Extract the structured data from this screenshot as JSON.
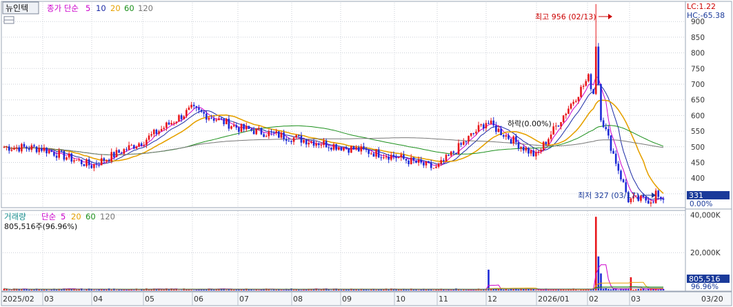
{
  "stock_name": "뉴인텍",
  "price_panel": {
    "ma_label": "종가 단순",
    "ma_periods": [
      {
        "label": "5",
        "color": "#cc00cc"
      },
      {
        "label": "10",
        "color": "#1c2ba6"
      },
      {
        "label": "20",
        "color": "#e6a100"
      },
      {
        "label": "60",
        "color": "#1a8f1a"
      },
      {
        "label": "120",
        "color": "#777777"
      }
    ],
    "lc": "LC:1.22",
    "hc": "HC:-65.38",
    "high_annotation": "최고 956 (02/13)",
    "low_annotation": "최저 327 (03/17)",
    "ref_annotation": "하락(0.00%)",
    "current_price": "331",
    "current_change": "0.00%"
  },
  "volume_panel": {
    "title": "거래량",
    "ma_label": "단순",
    "ma_periods": [
      {
        "label": "5",
        "color": "#cc00cc"
      },
      {
        "label": "20",
        "color": "#e6a100"
      },
      {
        "label": "60",
        "color": "#1a8f1a"
      },
      {
        "label": "120",
        "color": "#777777"
      }
    ],
    "volume_info": "805,516주(96.96%)",
    "current_volume": "805,516",
    "current_volume_pct": "96.96%"
  },
  "colors": {
    "up": "#e8161b",
    "down": "#1d2ad6",
    "accent": "#1a3a9a"
  },
  "chart_data": {
    "type": "candlestick",
    "x_tick_labels": [
      "2025/02",
      "03",
      "04",
      "05",
      "06",
      "07",
      "08",
      "09",
      "10",
      "11",
      "12",
      "2026/01",
      "02",
      "03",
      "03/20"
    ],
    "price_axis": {
      "ticks": [
        350,
        400,
        450,
        500,
        550,
        600,
        650,
        700,
        750,
        800,
        850,
        900
      ],
      "ylim": [
        310,
        960
      ]
    },
    "volume_axis": {
      "ticks": [
        "20,000K",
        "40,000K"
      ],
      "ylim": [
        0,
        42000000
      ]
    },
    "price_anchors": [
      {
        "month": "2025/02",
        "close": 500
      },
      {
        "month": "03",
        "close": 495
      },
      {
        "month": "04",
        "close": 440
      },
      {
        "month": "05",
        "close": 520
      },
      {
        "month": "06",
        "close": 620
      },
      {
        "month": "07",
        "close": 560
      },
      {
        "month": "08",
        "close": 530
      },
      {
        "month": "09",
        "close": 500
      },
      {
        "month": "10",
        "close": 470
      },
      {
        "month": "11",
        "close": 430
      },
      {
        "month": "12",
        "close": 580
      },
      {
        "month": "2026/01",
        "close": 470
      },
      {
        "month": "02",
        "close": 720
      },
      {
        "month": "03",
        "close": 331
      }
    ],
    "high": {
      "value": 956,
      "date": "02/13"
    },
    "low": {
      "value": 327,
      "date": "03/17"
    },
    "last_close": 331,
    "last_volume": 805516,
    "notable_volumes": [
      {
        "month": "12",
        "volume": 11000000
      },
      {
        "month": "02",
        "volume": 39000000
      },
      {
        "month": "03",
        "volume": 7000000
      }
    ]
  }
}
